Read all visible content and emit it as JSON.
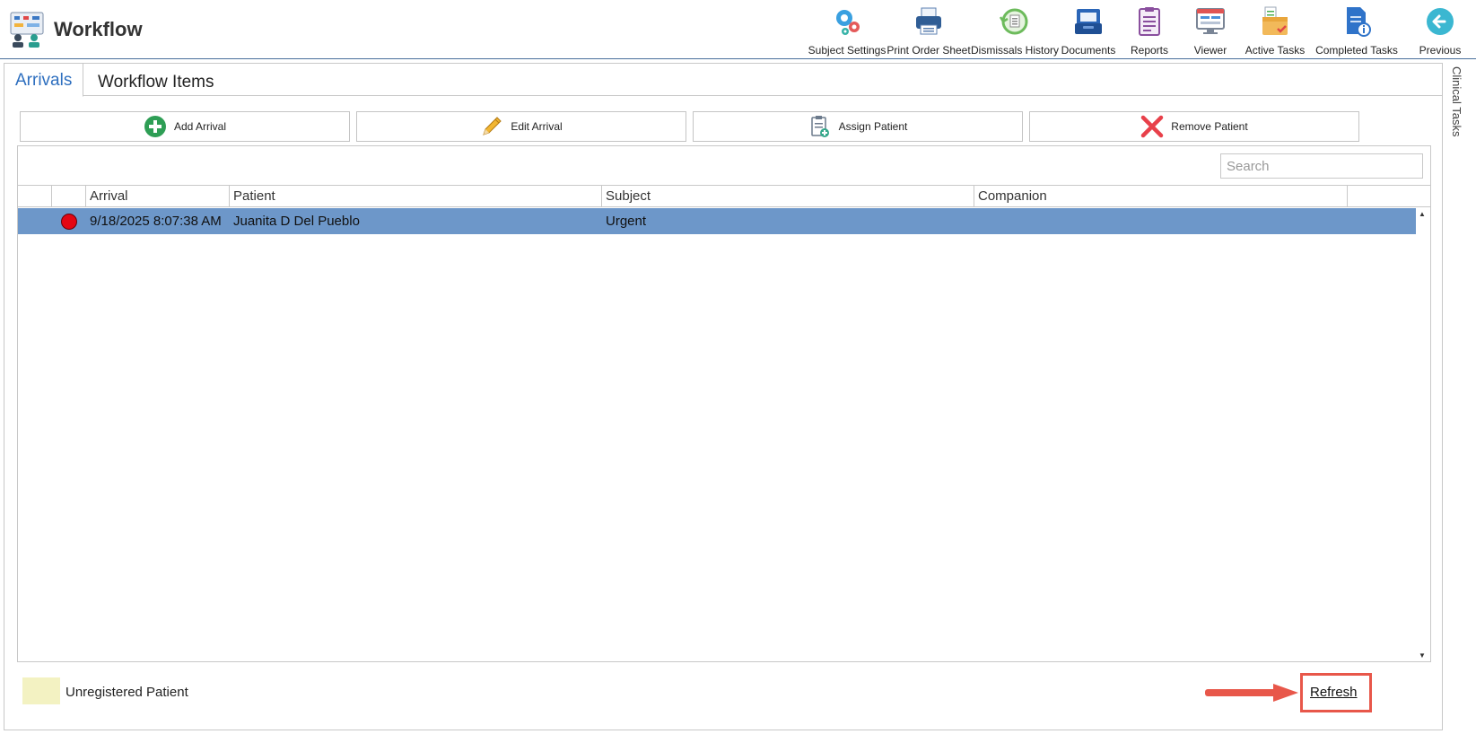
{
  "app": {
    "title": "Workflow"
  },
  "toolbar": {
    "items": [
      {
        "label": "Subject Settings",
        "icon": "gears-icon"
      },
      {
        "label": "Print Order Sheet",
        "icon": "printer-icon"
      },
      {
        "label": "Dismissals History",
        "icon": "history-icon"
      },
      {
        "label": "Documents",
        "icon": "inbox-tray-icon"
      },
      {
        "label": "Reports",
        "icon": "clipboard-report-icon"
      },
      {
        "label": "Viewer",
        "icon": "monitor-viewer-icon"
      },
      {
        "label": "Active Tasks",
        "icon": "task-box-icon"
      },
      {
        "label": "Completed Tasks",
        "icon": "document-info-icon"
      },
      {
        "label": "Previous",
        "icon": "back-arrow-icon"
      }
    ]
  },
  "tabs": {
    "arrivals": "Arrivals",
    "workflow_items": "Workflow Items"
  },
  "actions": {
    "add": "Add Arrival",
    "edit": "Edit Arrival",
    "assign": "Assign Patient",
    "remove": "Remove Patient"
  },
  "search": {
    "placeholder": "Search"
  },
  "grid": {
    "columns": [
      "Arrival",
      "Patient",
      "Subject",
      "Companion"
    ],
    "rows": [
      {
        "status_color": "#e30613",
        "arrival": "9/18/2025 8:07:38 AM",
        "patient": "Juanita D Del Pueblo",
        "subject": "Urgent",
        "companion": ""
      }
    ]
  },
  "legend": {
    "label": "Unregistered Patient",
    "color": "#f3f2c2"
  },
  "footer": {
    "refresh_label": "Refresh"
  },
  "side_panel": {
    "label": "Clinical Tasks"
  },
  "colors": {
    "selected_row": "#6d97c9",
    "accent": "#2e6fbf",
    "highlight": "#e8574a"
  }
}
